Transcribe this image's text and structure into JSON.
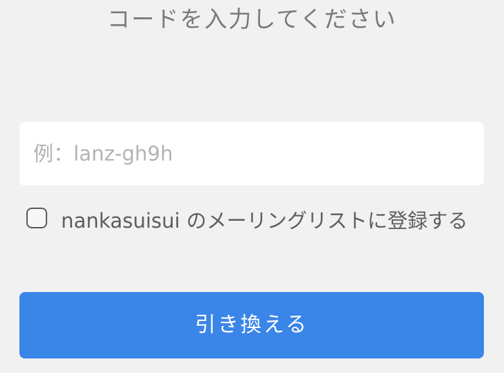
{
  "header": {
    "title": "コードを入力してください"
  },
  "code_field": {
    "placeholder": "例：lanz-gh9h",
    "value": ""
  },
  "mailing_list": {
    "checked": false,
    "label": "nankasuisui のメーリングリストに登録する"
  },
  "submit": {
    "label": "引き換える"
  },
  "colors": {
    "background": "#f1f1f1",
    "button": "#3a85e8",
    "title_text": "#7a7a7a",
    "placeholder_text": "#b3b3b3"
  }
}
